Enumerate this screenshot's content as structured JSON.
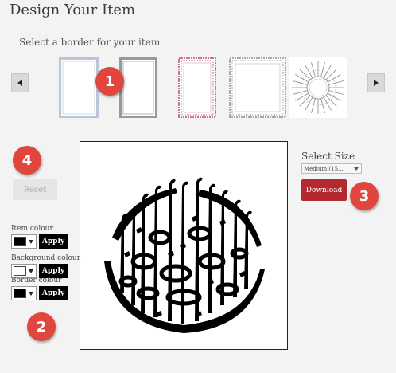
{
  "page": {
    "title": "Design Your Item",
    "subtitle": "Select a border for your item"
  },
  "carousel": {
    "prev_icon": "chevron-left-icon",
    "next_icon": "chevron-right-icon",
    "thumbnails": [
      {
        "name": "border-light-blue",
        "color": "#b8c6d8"
      },
      {
        "name": "border-grey",
        "color": "#9a9a9a"
      },
      {
        "name": "border-pink-ornate",
        "color": "#c97a8a"
      },
      {
        "name": "border-grey-ornate",
        "color": "#a8a8a8"
      },
      {
        "name": "border-circular-mandala",
        "color": "#888888"
      }
    ]
  },
  "badges": [
    "1",
    "2",
    "3",
    "4"
  ],
  "reset": {
    "label": "Reset"
  },
  "colours": {
    "item": {
      "label": "Item colour",
      "value": "#000000",
      "apply_label": "Apply"
    },
    "background": {
      "label": "Background colour",
      "value": "#ffffff",
      "apply_label": "Apply"
    },
    "border": {
      "label": "Border colour",
      "value": "#000000",
      "apply_label": "Apply"
    }
  },
  "size": {
    "label": "Select Size",
    "selected": "Medium (15..."
  },
  "download": {
    "label": "Download",
    "color": "#b22a2f"
  },
  "accent": "#e0463e"
}
